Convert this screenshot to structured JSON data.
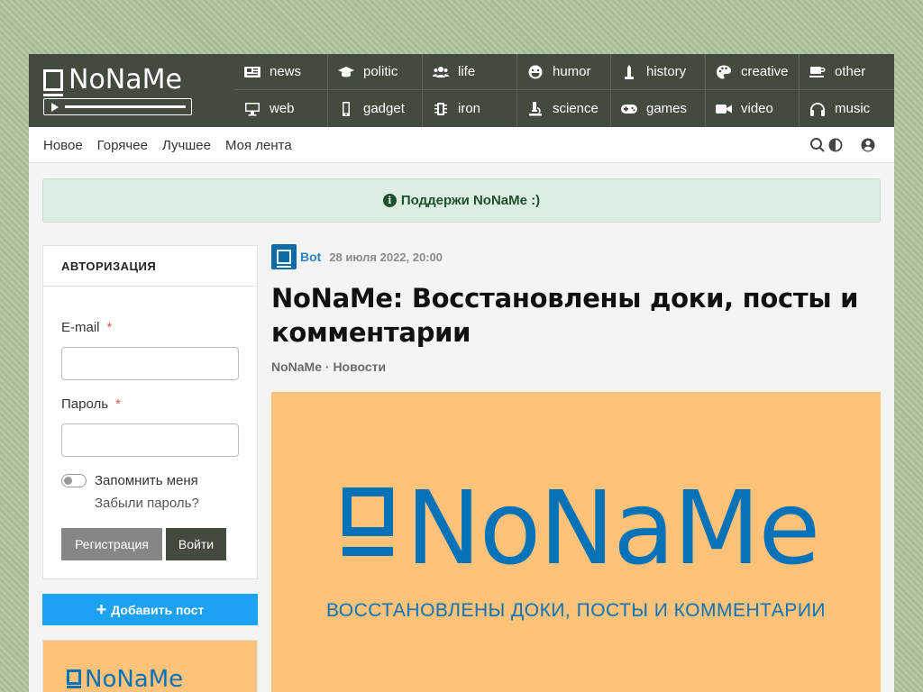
{
  "logo": {
    "text": "NoNaMe"
  },
  "nav": [
    {
      "label": "news",
      "icon": "newspaper-icon"
    },
    {
      "label": "politic",
      "icon": "graduation-cap-icon"
    },
    {
      "label": "life",
      "icon": "users-icon"
    },
    {
      "label": "humor",
      "icon": "laugh-icon"
    },
    {
      "label": "history",
      "icon": "monument-icon"
    },
    {
      "label": "creative",
      "icon": "palette-icon"
    },
    {
      "label": "other",
      "icon": "coffee-icon"
    },
    {
      "label": "web",
      "icon": "desktop-icon"
    },
    {
      "label": "gadget",
      "icon": "mobile-icon"
    },
    {
      "label": "iron",
      "icon": "memory-icon"
    },
    {
      "label": "science",
      "icon": "microscope-icon"
    },
    {
      "label": "games",
      "icon": "gamepad-icon"
    },
    {
      "label": "video",
      "icon": "video-camera-icon"
    },
    {
      "label": "music",
      "icon": "headphones-icon"
    }
  ],
  "subnav": {
    "links": [
      "Новое",
      "Горячее",
      "Лучшее",
      "Моя лента"
    ],
    "tools": [
      "search-icon",
      "contrast-icon",
      "user-icon"
    ]
  },
  "notice": {
    "text": "Поддержи NoNaMe :)",
    "icon": "info-circle-icon",
    "color": "#1f5131"
  },
  "auth": {
    "title": "АВТОРИЗАЦИЯ",
    "email_label": "E-mail",
    "password_label": "Пароль",
    "required_mark": "*",
    "remember_label": "Запомнить меня",
    "forgot_label": "Забыли пароль?",
    "register_label": "Регистрация",
    "login_label": "Войти"
  },
  "sidebar": {
    "add_post_label": "Добавить пост",
    "banner_text": "NoNaMe"
  },
  "post": {
    "author": "Bot",
    "date": "28 июля 2022, 20:00",
    "title": "NoNaMe: Восстановлены доки, посты и комментарии",
    "categories": "NoNaMe · Новости",
    "image_logo": "NoNaMe",
    "image_caption": "ВОССТАНОВЛЕНЫ ДОКИ, ПОСТЫ И КОММЕНТАРИИ"
  },
  "colors": {
    "header": "#434b3f",
    "accent_blue": "#1da1f2",
    "brand_blue": "#0673b8",
    "banner_bg": "#ffc278",
    "notice_bg": "#dcede1"
  }
}
